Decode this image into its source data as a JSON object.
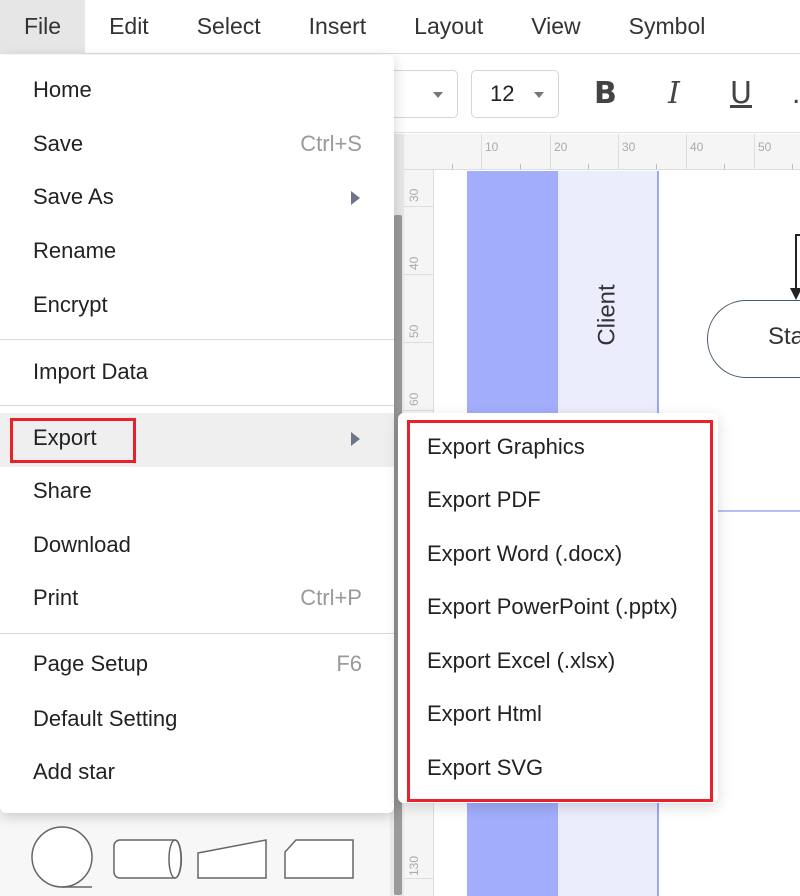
{
  "menubar": {
    "items": [
      {
        "label": "File",
        "active": true
      },
      {
        "label": "Edit"
      },
      {
        "label": "Select"
      },
      {
        "label": "Insert"
      },
      {
        "label": "Layout"
      },
      {
        "label": "View"
      },
      {
        "label": "Symbol"
      }
    ]
  },
  "toolbar": {
    "font_family_value": "",
    "font_size_value": "12",
    "bold_label": "B",
    "italic_label": "I",
    "underline_label": "U",
    "more_label": "."
  },
  "rulers": {
    "horizontal": [
      "10",
      "20",
      "30",
      "40",
      "50"
    ],
    "vertical": [
      "30",
      "40",
      "50",
      "60",
      "130"
    ]
  },
  "canvas": {
    "lane_label": "Client",
    "start_shape_label": "Sta",
    "colors": {
      "lane_header": "#a2aefc",
      "lane_body": "#ebedfd"
    }
  },
  "file_menu": {
    "items": [
      {
        "label": "Home"
      },
      {
        "label": "Save",
        "shortcut": "Ctrl+S"
      },
      {
        "label": "Save As",
        "submenu": true
      },
      {
        "label": "Rename"
      },
      {
        "label": "Encrypt"
      },
      {
        "label": "Import Data"
      },
      {
        "label": "Export",
        "submenu": true,
        "highlighted": true
      },
      {
        "label": "Share"
      },
      {
        "label": "Download"
      },
      {
        "label": "Print",
        "shortcut": "Ctrl+P"
      },
      {
        "label": "Page Setup",
        "shortcut": "F6"
      },
      {
        "label": "Default Setting"
      },
      {
        "label": "Add star"
      }
    ]
  },
  "export_submenu": {
    "items": [
      {
        "label": "Export Graphics"
      },
      {
        "label": "Export PDF"
      },
      {
        "label": "Export Word (.docx)"
      },
      {
        "label": "Export PowerPoint (.pptx)"
      },
      {
        "label": "Export Excel (.xlsx)"
      },
      {
        "label": "Export Html"
      },
      {
        "label": "Export SVG"
      }
    ]
  },
  "annotation": {
    "highlight_color": "#e8212b"
  }
}
